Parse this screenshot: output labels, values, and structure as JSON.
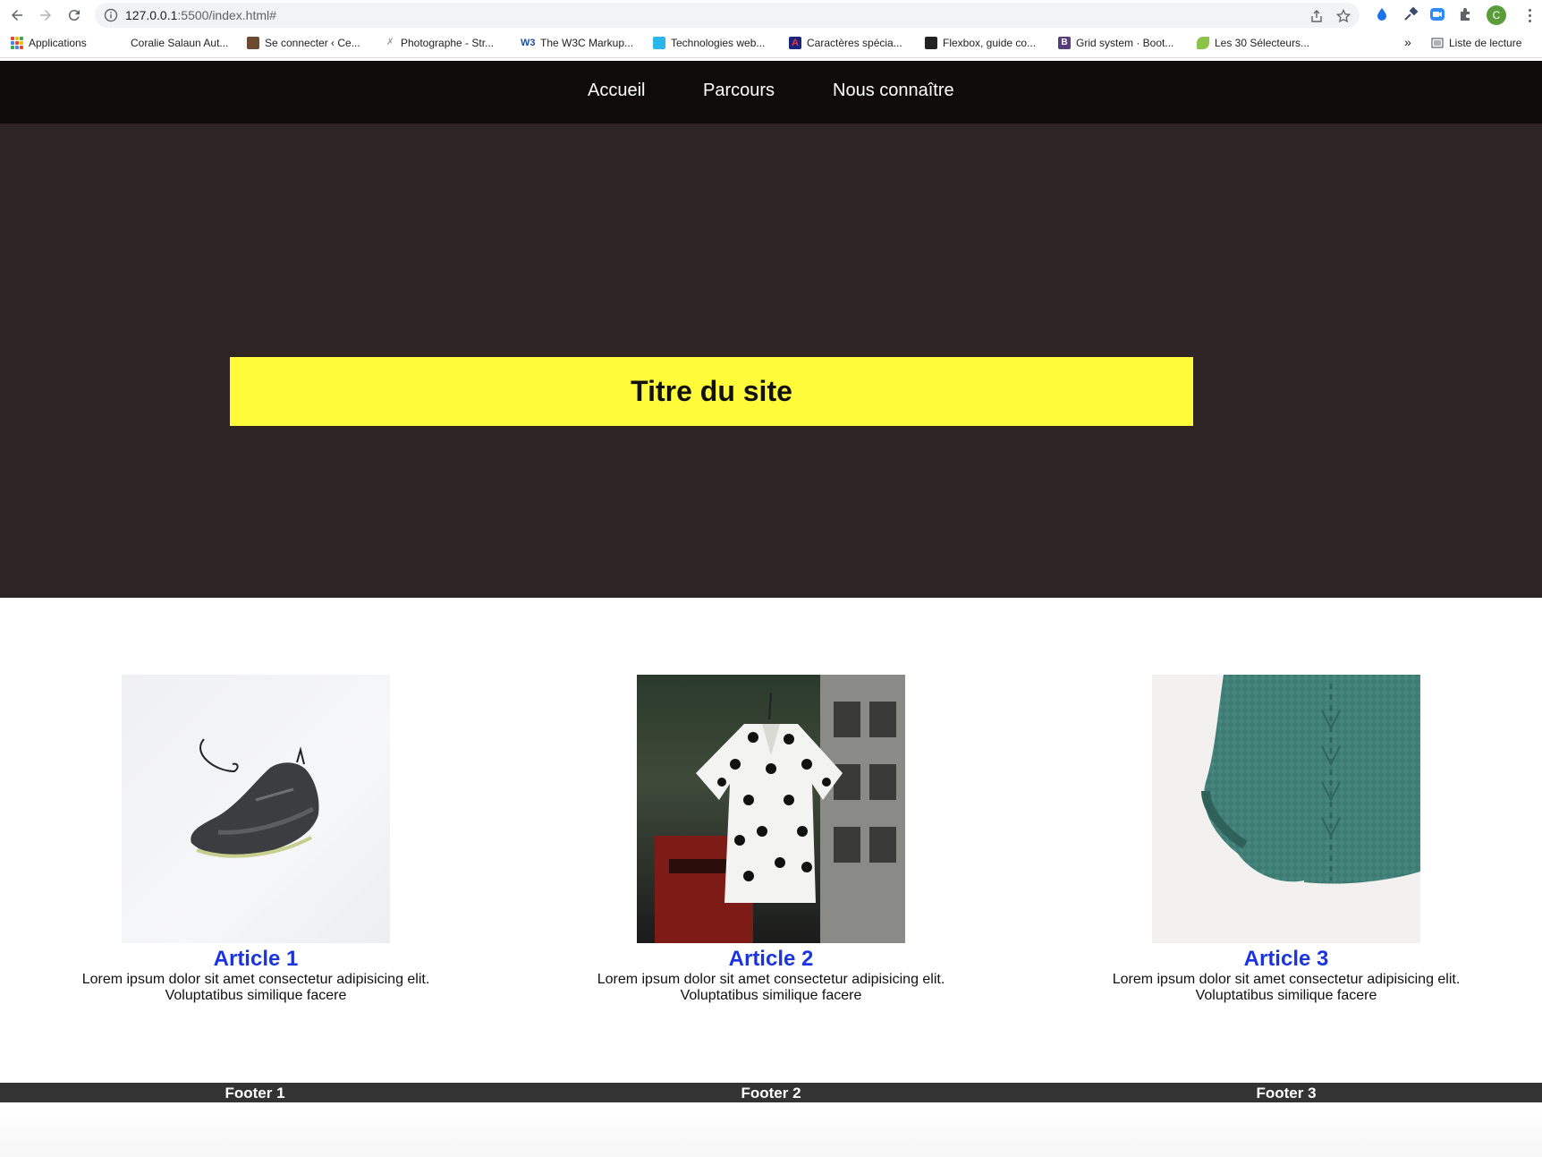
{
  "browser": {
    "url_host": "127.0.0.1",
    "url_path": ":5500/index.html#",
    "profile_initial": "C",
    "bookmarks": [
      {
        "label": "Applications"
      },
      {
        "label": "Coralie Salaun Aut..."
      },
      {
        "label": "Se connecter ‹ Ce..."
      },
      {
        "label": "Photographe - Str..."
      },
      {
        "label": "The W3C Markup..."
      },
      {
        "label": "Technologies web..."
      },
      {
        "label": "Caractères spécia..."
      },
      {
        "label": "Flexbox, guide co..."
      },
      {
        "label": "Grid system · Boot..."
      },
      {
        "label": "Les 30 Sélecteurs..."
      }
    ],
    "overflow_label": "»",
    "reading_list_label": "Liste de lecture"
  },
  "nav": {
    "items": [
      "Accueil",
      "Parcours",
      "Nous connaître"
    ]
  },
  "hero": {
    "title": "Titre du site"
  },
  "articles": [
    {
      "title": "Article 1",
      "text_line1": "Lorem ipsum dolor sit amet consectetur adipisicing elit.",
      "text_line2": "Voluptatibus similique facere",
      "image": "sneaker-photo"
    },
    {
      "title": "Article 2",
      "text_line1": "Lorem ipsum dolor sit amet consectetur adipisicing elit.",
      "text_line2": "Voluptatibus similique facere",
      "image": "polka-dot-shirt-photo"
    },
    {
      "title": "Article 3",
      "text_line1": "Lorem ipsum dolor sit amet consectetur adipisicing elit.",
      "text_line2": "Voluptatibus similique facere",
      "image": "green-sweater-photo"
    }
  ],
  "footer": {
    "items": [
      "Footer 1",
      "Footer 2",
      "Footer 3"
    ]
  },
  "colors": {
    "nav_bg": "#100b0b",
    "hero_bg": "#2f2424",
    "title_bg": "#fffb3a",
    "article_title": "#1a35e0",
    "footer_bg": "#333333"
  }
}
